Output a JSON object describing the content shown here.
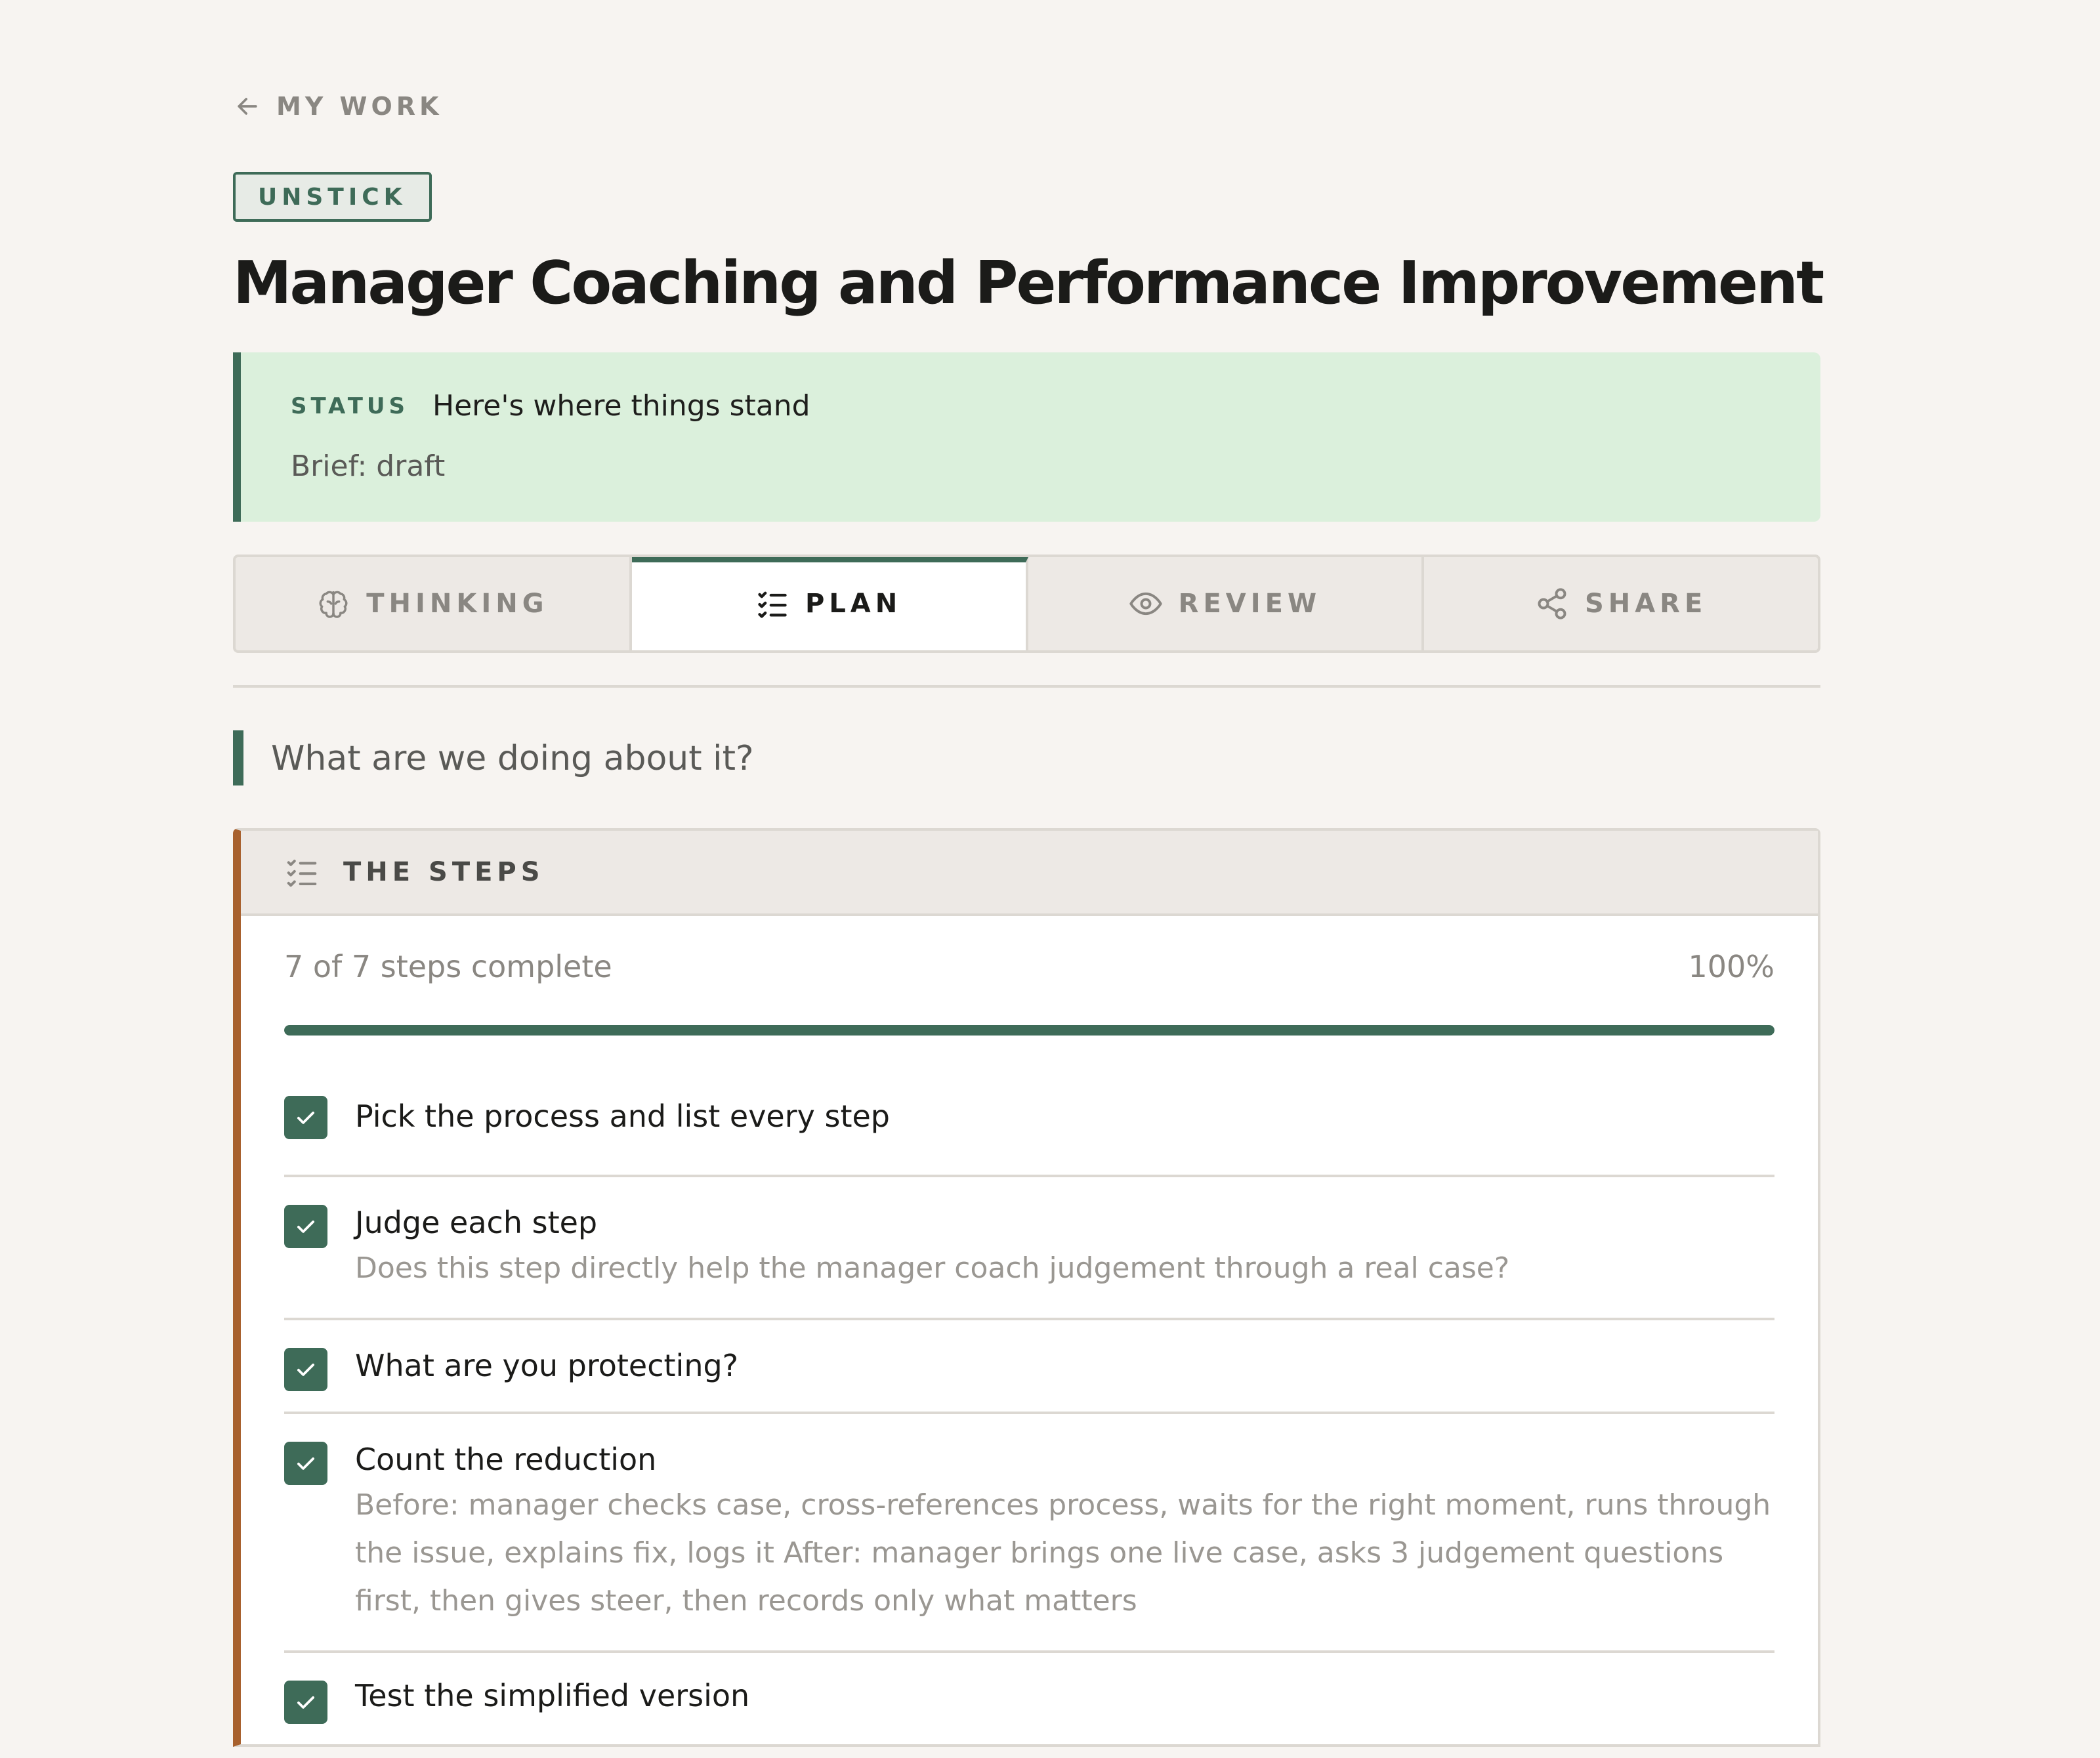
{
  "nav": {
    "back_label": "MY WORK"
  },
  "tag": "UNSTICK",
  "title": "Manager Coaching and Performance Improvement",
  "status": {
    "label": "STATUS",
    "text": "Here's where things stand",
    "sub": "Brief: draft"
  },
  "tabs": [
    {
      "label": "THINKING",
      "icon": "brain-icon",
      "active": false
    },
    {
      "label": "PLAN",
      "icon": "checklist-icon",
      "active": true
    },
    {
      "label": "REVIEW",
      "icon": "eye-icon",
      "active": false
    },
    {
      "label": "SHARE",
      "icon": "share-icon",
      "active": false
    }
  ],
  "section": {
    "heading": "What are we doing about it?"
  },
  "steps_card": {
    "title": "THE STEPS",
    "icon": "checklist-icon",
    "progress_text": "7 of 7 steps complete",
    "progress_pct": "100%",
    "progress_value": 1.0,
    "steps": [
      {
        "title": "Pick the process and list every step",
        "desc": "",
        "checked": true
      },
      {
        "title": "Judge each step",
        "desc": "Does this step directly help the manager coach judgement through a real case?",
        "checked": true
      },
      {
        "title": "What are you protecting?",
        "desc": "",
        "checked": true
      },
      {
        "title": "Count the reduction",
        "desc": "Before: manager checks case, cross-references process, waits for the right moment, runs through the issue, explains fix, logs it After: manager brings one live case, asks 3 judgement questions first, then gives steer, then records only what matters",
        "checked": true
      },
      {
        "title": "Test the simplified version",
        "desc": "",
        "checked": true
      }
    ]
  },
  "colors": {
    "accent": "#3e6b58",
    "card_accent": "#a8612e",
    "status_bg": "#dbf0dc",
    "page_bg": "#f7f4f1"
  }
}
